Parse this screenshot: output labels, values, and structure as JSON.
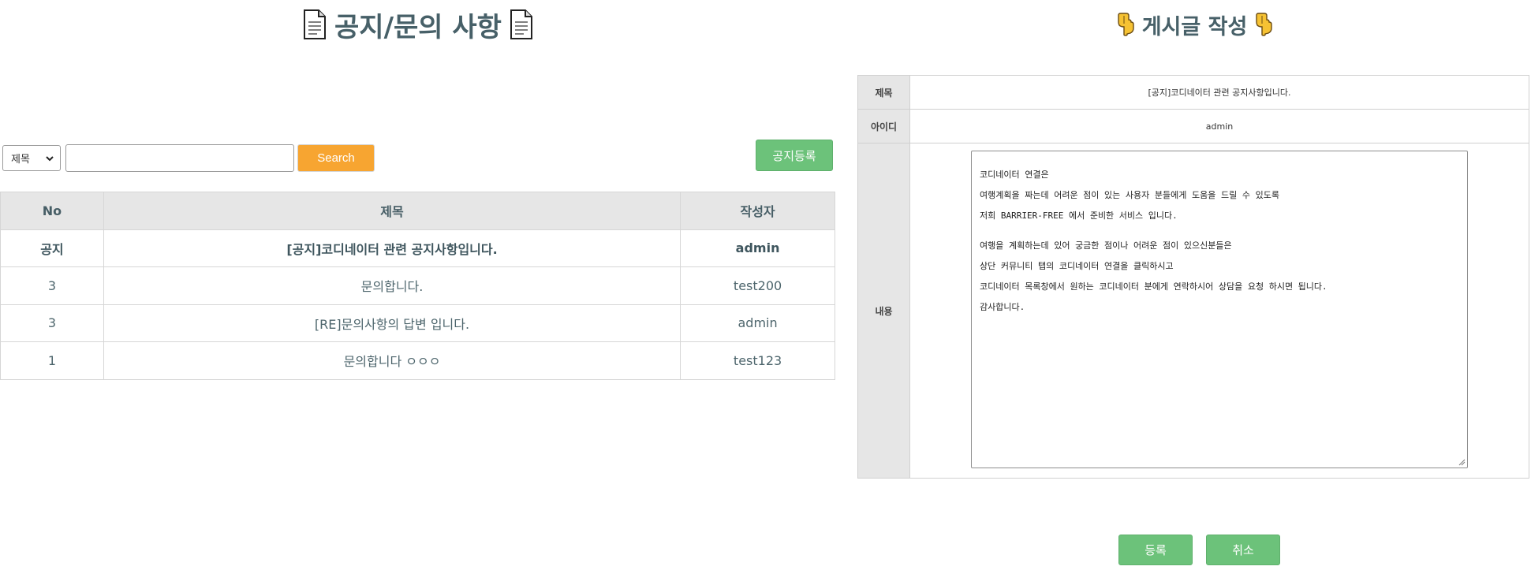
{
  "left": {
    "title": "공지/문의 사항",
    "icons": {
      "title_left": "document-icon",
      "title_right": "document-icon"
    },
    "search": {
      "select_value": "제목",
      "input_value": "",
      "button_label": "Search"
    },
    "notice_button_label": "공지등록",
    "table": {
      "headers": [
        "No",
        "제목",
        "작성자"
      ],
      "rows": [
        {
          "no": "공지",
          "title": "[공지]코디네이터 관련 공지사항입니다.",
          "author": "admin",
          "notice": true
        },
        {
          "no": "3",
          "title": "문의합니다.",
          "author": "test200",
          "notice": false
        },
        {
          "no": "3",
          "title": "[RE]문의사항의 답변 입니다.",
          "author": "admin",
          "notice": false
        },
        {
          "no": "1",
          "title": "문의합니다 ㅇㅇㅇ",
          "author": "test123",
          "notice": false
        }
      ]
    }
  },
  "right": {
    "title": "게시글 작성",
    "icons": {
      "title_left": "pointing-down-hand-icon",
      "title_right": "pointing-down-hand-icon"
    },
    "form": {
      "title_label": "제목",
      "title_value": "[공지]코디네이터 관련 공지사항입니다.",
      "id_label": "아이디",
      "id_value": "admin",
      "content_label": "내용",
      "content_lines": [
        "코디네이터 연결은",
        "여행계획을 짜는데 어려운 점이 있는 사용자 분들에게 도움을 드릴 수 있도록",
        "저희 BARRIER-FREE 에서 준비한 서비스 입니다.",
        "",
        "여행을 계획하는데 있어 궁금한 점이나 어려운 점이 있으신분들은",
        "상단 커뮤니티 탭의 코디네이터 연결을 클릭하시고",
        "코디네이터 목록창에서 원하는 코디네이터 분에게 연락하시어 상담을 요청 하시면 됩니다.",
        "감사합니다."
      ]
    },
    "submit_label": "등록",
    "cancel_label": "취소"
  },
  "colors": {
    "heading": "#476068",
    "search_button": "#f7a531",
    "action_button": "#6cc27a",
    "table_header_bg": "#e6e6e6"
  }
}
